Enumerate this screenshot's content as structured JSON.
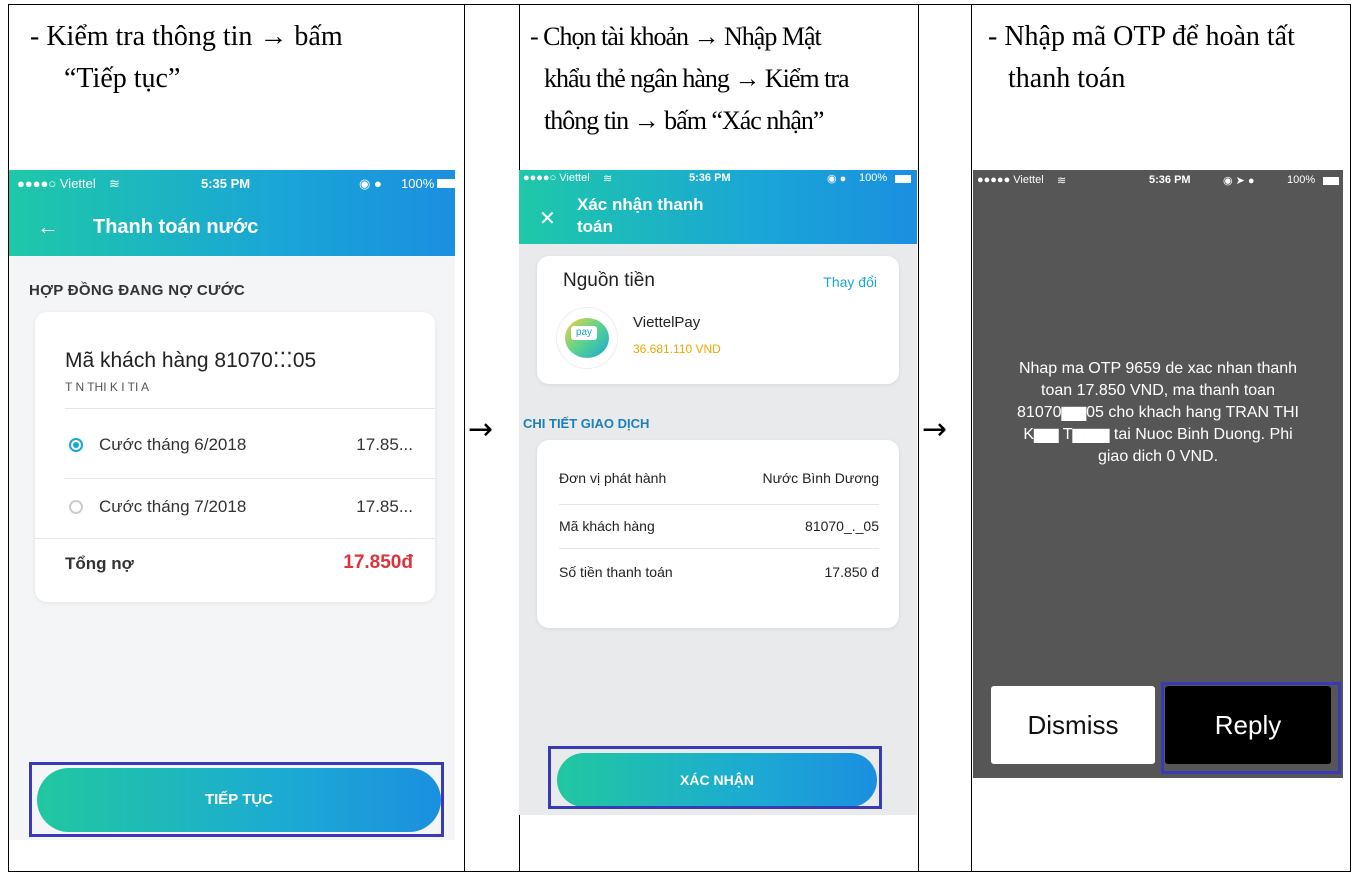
{
  "columns": [
    {
      "caption_lines": [
        "-   Kiểm tra thông tin",
        "“Tiếp tục”"
      ],
      "caption_arrow_text": "bấm"
    },
    {
      "caption_lines": [
        "- Chọn tài khoản",
        "Nhập Mật",
        "khẩu thẻ ngân hàng",
        "Kiểm tra",
        "thông tin",
        "bấm “Xác nhận”"
      ]
    },
    {
      "caption_lines": [
        "- Nhập mã OTP để hoàn tất",
        "thanh toán"
      ]
    }
  ],
  "arrow_glyph": "→",
  "screen1": {
    "status": {
      "carrier": "●●●●○ Viettel",
      "time": "5:35 PM",
      "battery": "100%"
    },
    "title": "Thanh toán nước",
    "section": "HỢP ĐỒNG ĐANG NỢ CƯỚC",
    "customer_label": "Mã khách hàng 81070⁚⁚⁚05",
    "customer_name": "T    N THI K    I TI    A",
    "bills": [
      {
        "label": "Cước tháng 6/2018",
        "amount": "17.85..."
      },
      {
        "label": "Cước tháng 7/2018",
        "amount": "17.85..."
      }
    ],
    "total_label": "Tổng nợ",
    "total_value": "17.850đ",
    "button": "TIẾP TỤC"
  },
  "screen2": {
    "status": {
      "carrier": "●●●●○ Viettel",
      "time": "5:36 PM",
      "battery": "100%"
    },
    "title_line1": "Xác nhận thanh",
    "title_line2": "toán",
    "source_label": "Nguồn tiền",
    "change_link": "Thay đổi",
    "wallet_name": "ViettelPay",
    "wallet_balance": "36.681.110 VND",
    "logo_text": "pay",
    "section": "CHI TIẾT GIAO DỊCH",
    "details": [
      {
        "label": "Đơn vị phát hành",
        "value": "Nước Bình Dương"
      },
      {
        "label": "Mã khách hàng",
        "value": "81070_._05"
      },
      {
        "label": "Số tiền thanh toán",
        "value": "17.850 đ"
      }
    ],
    "button": "XÁC NHẬN"
  },
  "screen3": {
    "status": {
      "carrier": "●●●●● Viettel",
      "time": "5:36 PM",
      "battery": "100%"
    },
    "message_lines": [
      "Nhap ma OTP 9659 de xac nhan thanh",
      "toan 17.850 VND, ma thanh toan",
      "81070▆▆05 cho khach hang TRAN THI",
      "K▆▆ T▆▆▆ tai Nuoc Binh Duong. Phi",
      "giao dich 0 VND."
    ],
    "dismiss": "Dismiss",
    "reply": "Reply"
  },
  "colors": {
    "accent": "#1aa6d6",
    "teal": "#1ec8a8",
    "highlight": "#3a3ab8",
    "total_red": "#e0323a"
  }
}
